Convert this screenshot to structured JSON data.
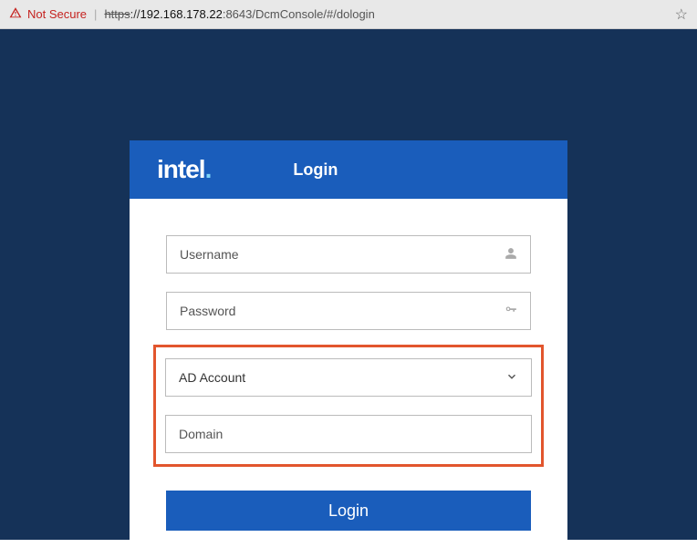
{
  "browser": {
    "security_label": "Not Secure",
    "url_scheme": "https",
    "url_host": "192.168.178.22",
    "url_port": ":8643",
    "url_path": "/DcmConsole/#/dologin"
  },
  "header": {
    "logo_text": "intel",
    "title": "Login"
  },
  "form": {
    "username_placeholder": "Username",
    "password_placeholder": "Password",
    "account_type_selected": "AD Account",
    "domain_placeholder": "Domain",
    "login_button": "Login"
  }
}
